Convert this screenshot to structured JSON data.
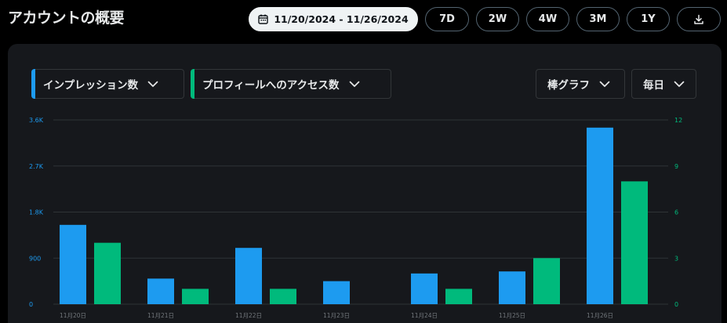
{
  "header": {
    "title": "アカウントの概要"
  },
  "range_bar": {
    "date_range": "11/20/2024 - 11/26/2024",
    "ranges": [
      "7D",
      "2W",
      "4W",
      "3M",
      "1Y"
    ]
  },
  "controls": {
    "metric_primary": "インプレッション数",
    "metric_secondary": "プロフィールへのアクセス数",
    "chart_type": "棒グラフ",
    "frequency": "毎日"
  },
  "colors": {
    "primary_series": "#1d9bf0",
    "secondary_series": "#00ba7c",
    "panel_bg": "#16181c",
    "page_bg": "#000000",
    "axis_text": "#71767b"
  },
  "icons": {
    "date": "calendar-icon",
    "download": "download-icon",
    "dropdown": "chevron-down-icon"
  },
  "chart_data": {
    "type": "bar",
    "categories": [
      "11月20日",
      "11月21日",
      "11月22日",
      "11月23日",
      "11月24日",
      "11月25日",
      "11月26日"
    ],
    "series": [
      {
        "name": "インプレッション数",
        "axis": "left",
        "values": [
          1550,
          500,
          1100,
          450,
          600,
          640,
          3450
        ]
      },
      {
        "name": "プロフィールへのアクセス数",
        "axis": "right",
        "values": [
          4,
          1,
          1,
          0,
          1,
          3,
          8
        ]
      }
    ],
    "left_axis": {
      "ticks": [
        "0",
        "900",
        "1.8K",
        "2.7K",
        "3.6K"
      ],
      "ylim": [
        0,
        3600
      ]
    },
    "right_axis": {
      "ticks": [
        "0",
        "3",
        "6",
        "9",
        "12"
      ],
      "ylim": [
        0,
        12
      ]
    },
    "grid": true
  }
}
